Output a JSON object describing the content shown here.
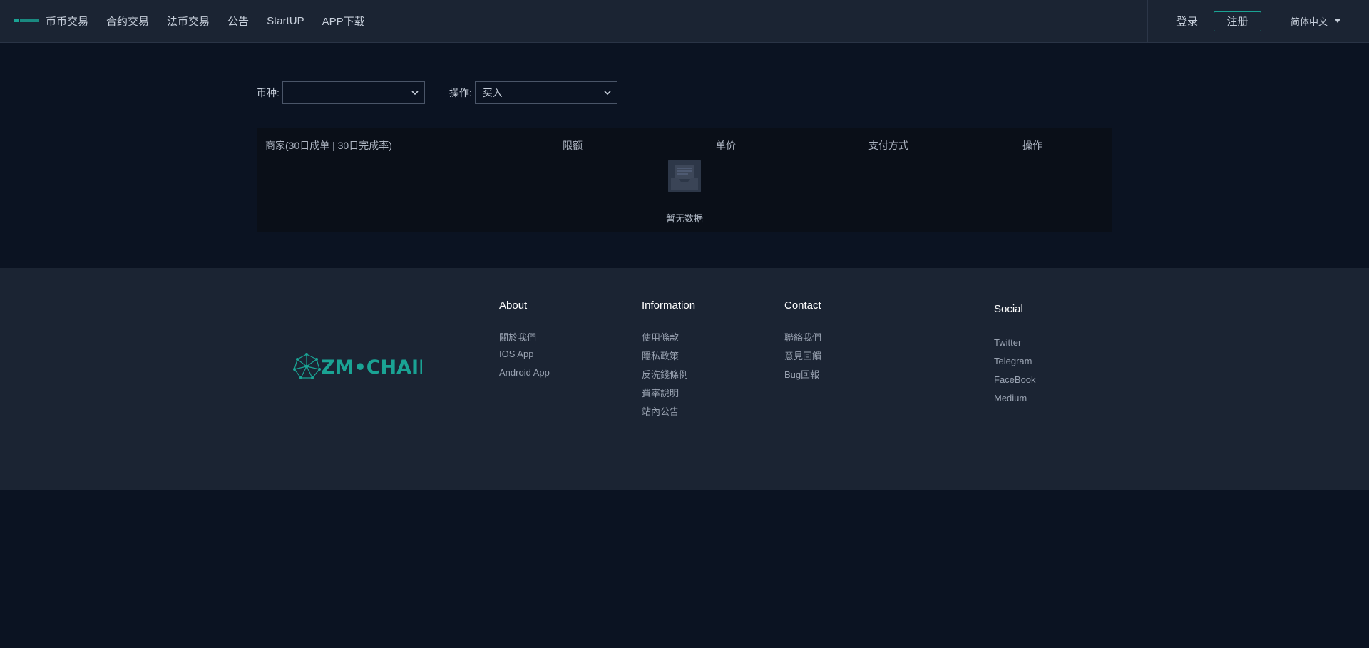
{
  "header": {
    "nav": [
      "币币交易",
      "合约交易",
      "法币交易",
      "公告",
      "StartUP",
      "APP下载"
    ],
    "login": "登录",
    "register": "注册",
    "language": "简体中文"
  },
  "filters": {
    "coin_label": "币种:",
    "coin_value": "",
    "action_label": "操作:",
    "action_value": "买入"
  },
  "table": {
    "columns": [
      "商家(30日成单 | 30日完成率)",
      "限额",
      "单价",
      "支付方式",
      "操作"
    ],
    "empty_text": "暂无数据"
  },
  "footer": {
    "logo_text": "ZM•CHAIN",
    "about": {
      "title": "About",
      "links": [
        "關於我們",
        "IOS App",
        "Android App"
      ]
    },
    "information": {
      "title": "Information",
      "links": [
        "使用條款",
        "隱私政策",
        "反洗錢條例",
        "費率說明",
        "站內公告"
      ]
    },
    "contact": {
      "title": "Contact",
      "links": [
        "聯絡我們",
        "意見回饋",
        "Bug回報"
      ]
    },
    "social": {
      "title": "Social",
      "links": [
        "Twitter",
        "Telegram",
        "FaceBook",
        "Medium"
      ]
    }
  },
  "colors": {
    "accent": "#1aa394",
    "background": "#0b1322",
    "panel": "#1b2433"
  }
}
